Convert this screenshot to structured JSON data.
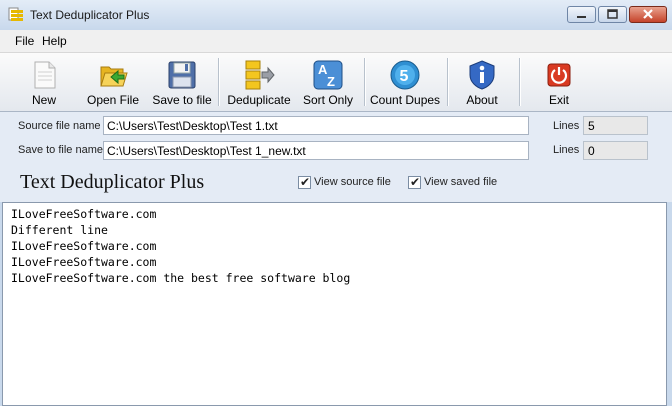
{
  "window": {
    "title": "Text Deduplicator Plus"
  },
  "menu": [
    "File",
    "Help"
  ],
  "toolbar": [
    {
      "label": "New",
      "icon": "new-document-icon"
    },
    {
      "label": "Open File",
      "icon": "open-folder-icon"
    },
    {
      "label": "Save to file",
      "icon": "floppy-disk-icon"
    },
    {
      "label": "Deduplicate",
      "icon": "deduplicate-icon"
    },
    {
      "label": "Sort Only",
      "icon": "sort-az-icon"
    },
    {
      "label": "Count Dupes",
      "icon": "count-dupes-icon"
    },
    {
      "label": "About",
      "icon": "info-icon"
    },
    {
      "label": "Exit",
      "icon": "power-icon"
    }
  ],
  "fields": {
    "source_label": "Source file name",
    "source_value": "C:\\Users\\Test\\Desktop\\Test 1.txt",
    "save_label": "Save to file name",
    "save_value": "C:\\Users\\Test\\Desktop\\Test 1_new.txt",
    "lines_label": "Lines",
    "source_lines": "5",
    "save_lines": "0"
  },
  "header": {
    "title": "Text Deduplicator Plus",
    "view_source_label": "View source file",
    "view_saved_label": "View saved file",
    "view_source_checked": true,
    "view_saved_checked": true
  },
  "text_content": [
    "ILoveFreeSoftware.com",
    "Different line",
    "ILoveFreeSoftware.com",
    "ILoveFreeSoftware.com",
    "ILoveFreeSoftware.com the best free software blog"
  ]
}
